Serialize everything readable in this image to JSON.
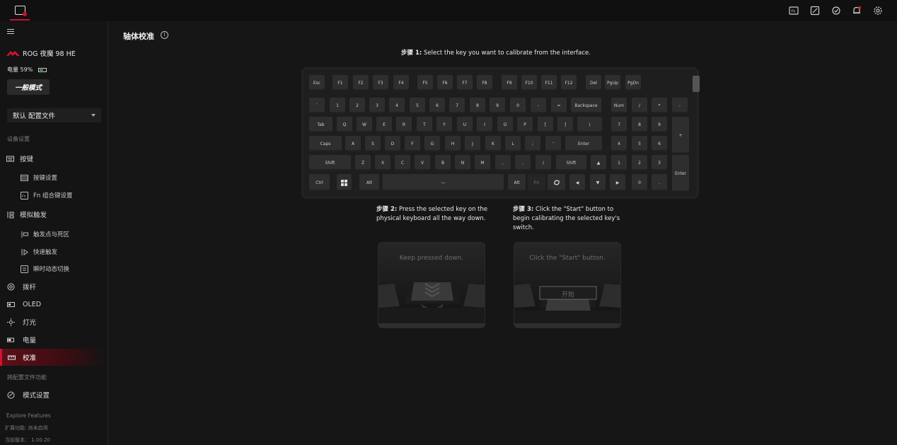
{
  "topbar": {
    "icons": [
      "fn-key-icon",
      "image-edit-icon",
      "sync-icon",
      "notification-bell-icon",
      "settings-gear-icon"
    ]
  },
  "sidebar": {
    "device_name": "ROG 夜魔 98 HE",
    "battery_label": "电量 59%",
    "battery_percent": 59,
    "mode_button": "一般模式",
    "profile_select": "默认 配置文件",
    "device_settings_label": "设备设置",
    "items": {
      "keys": "按键",
      "key_settings": "按键设置",
      "fn_combo": "Fn 组合键设置",
      "analog_trigger": "模拟触发",
      "actuation_deadzone": "触发点与死区",
      "rapid_trigger": "快速触发",
      "dynamic_switch": "瞬时动态切换",
      "joystick": "拨杆",
      "oled": "OLED",
      "lighting": "灯光",
      "power": "电量",
      "calibration": "校准"
    },
    "profile_features_label": "跨配置文件功能",
    "mode_settings": "模式设置",
    "footer": {
      "explore": "Explore Features",
      "extension": "扩展功能: 尚未启用",
      "version": "当前版本： 1.00.20"
    }
  },
  "main": {
    "title": "轴体校准",
    "step1_prefix": "步骤 1:",
    "step1_text": "Select the key you want to calibrate from the interface.",
    "step2_prefix": "步骤 2:",
    "step2_text": "Press the selected key on the physical keyboard all the way down.",
    "step3_prefix": "步骤 3:",
    "step3_text": "Click the \"Start\" button to begin calibrating the selected key's switch.",
    "image2_caption": "Keep pressed down.",
    "image3_caption": "Click the \"Start\" button.",
    "image3_button": "开始"
  },
  "keyboard": {
    "rows": [
      [
        "Esc",
        "F1",
        "F2",
        "F3",
        "F4",
        "F5",
        "F6",
        "F7",
        "F8",
        "F9",
        "F10",
        "F11",
        "F12",
        "Del",
        "PgUp",
        "PgDn"
      ],
      [
        "`",
        "1",
        "2",
        "3",
        "4",
        "5",
        "6",
        "7",
        "8",
        "9",
        "0",
        "-",
        "=",
        "Backspace",
        "Num",
        "/",
        "*",
        "-"
      ],
      [
        "Tab",
        "Q",
        "W",
        "E",
        "R",
        "T",
        "Y",
        "U",
        "I",
        "O",
        "P",
        "[",
        "]",
        "\\",
        "7",
        "8",
        "9",
        "+"
      ],
      [
        "Caps",
        "A",
        "S",
        "D",
        "F",
        "G",
        "H",
        "J",
        "K",
        "L",
        ";",
        "'",
        "Enter",
        "4",
        "5",
        "6"
      ],
      [
        "Shift",
        "Z",
        "X",
        "C",
        "V",
        "B",
        "N",
        "M",
        ",",
        ".",
        "/",
        "Shift",
        "▲",
        "1",
        "2",
        "3",
        "Enter"
      ],
      [
        "Ctrl",
        "Win",
        "Alt",
        "—",
        "Alt",
        "Fn",
        "Copilot",
        "◀",
        "▼",
        "▶",
        "0",
        "."
      ]
    ]
  }
}
